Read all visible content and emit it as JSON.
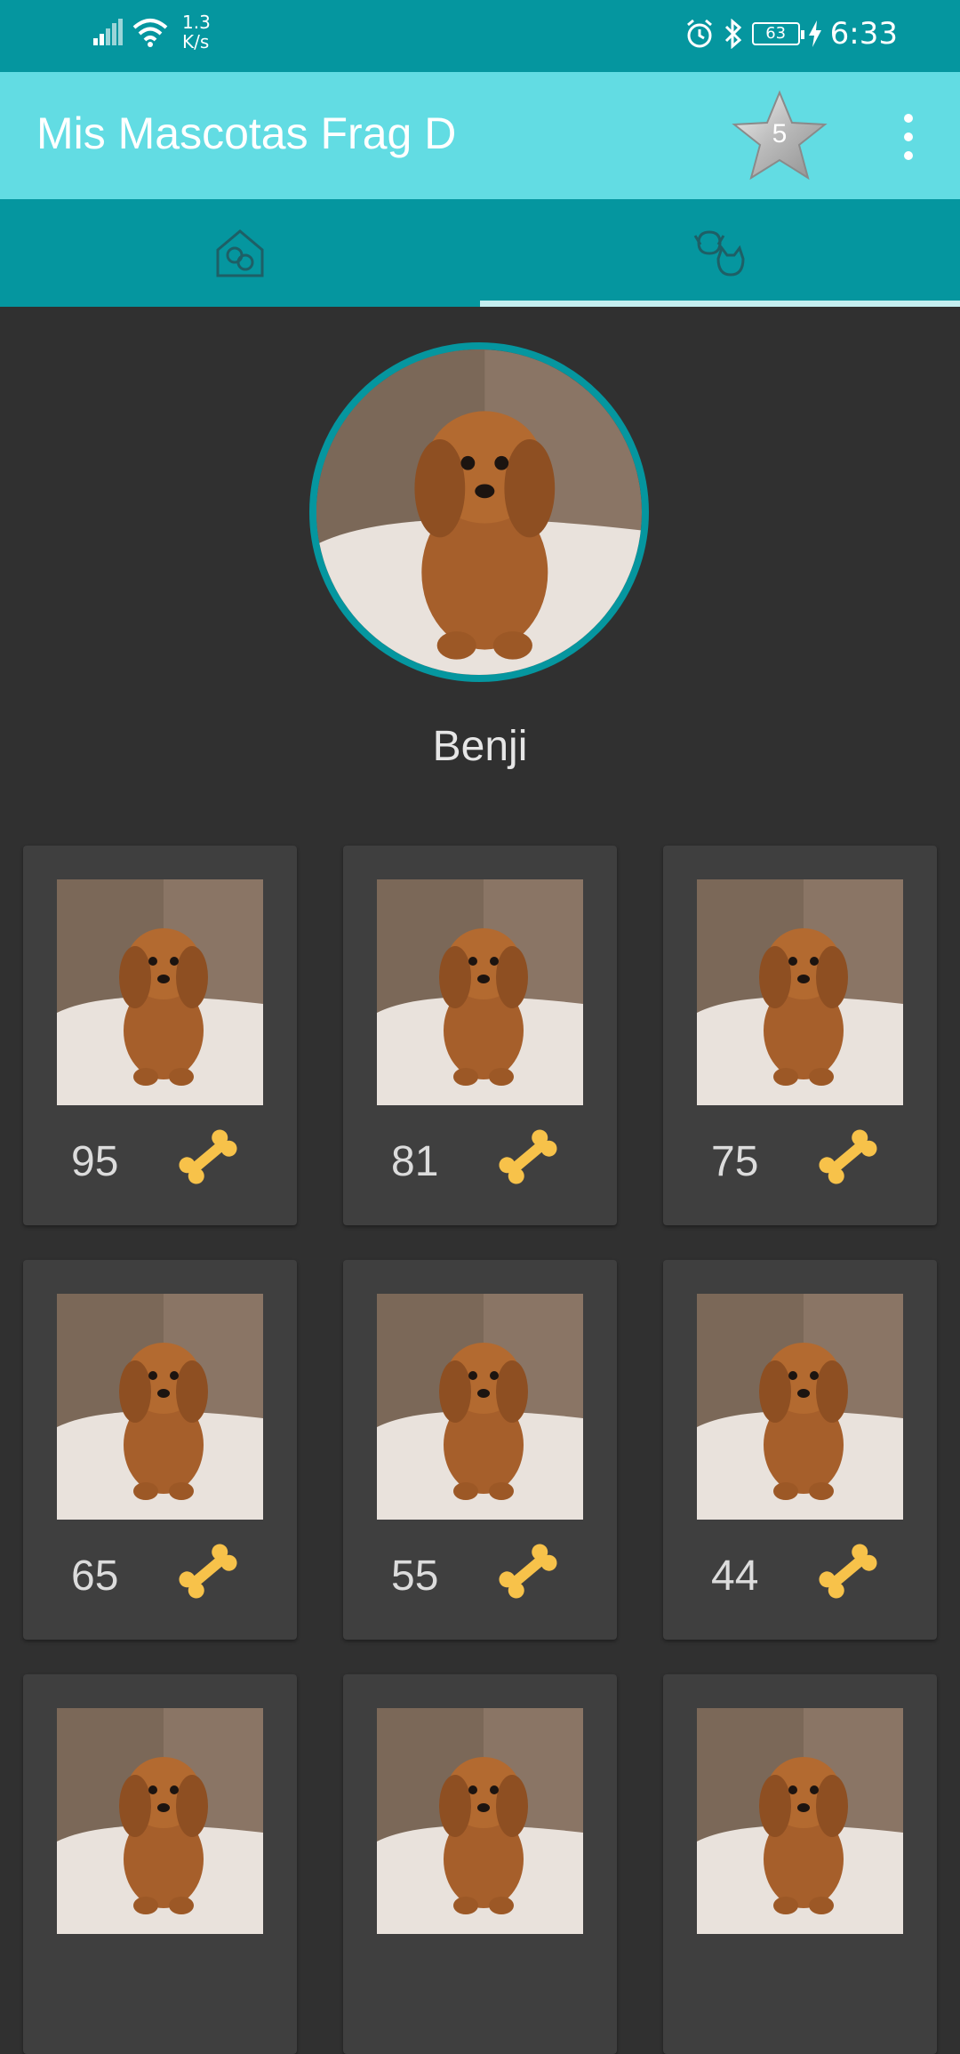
{
  "status_bar": {
    "network_speed_value": "1.3",
    "network_speed_unit": "K/s",
    "battery_level": "63",
    "time": "6:33"
  },
  "app_bar": {
    "title": "Mis Mascotas Frag D",
    "star_count": "5"
  },
  "tabs": [
    {
      "name": "home-pets",
      "icon": "house-pets-icon",
      "selected": false
    },
    {
      "name": "pet-profile",
      "icon": "dog-cat-icon",
      "selected": true
    }
  ],
  "profile": {
    "name": "Benji"
  },
  "grid": {
    "items": [
      {
        "rating": "95",
        "icon": "bone-icon"
      },
      {
        "rating": "81",
        "icon": "bone-icon"
      },
      {
        "rating": "75",
        "icon": "bone-icon"
      },
      {
        "rating": "65",
        "icon": "bone-icon"
      },
      {
        "rating": "55",
        "icon": "bone-icon"
      },
      {
        "rating": "44",
        "icon": "bone-icon"
      },
      {
        "rating": "",
        "icon": ""
      },
      {
        "rating": "",
        "icon": ""
      },
      {
        "rating": "",
        "icon": ""
      }
    ]
  },
  "colors": {
    "status_bar": "#05969f",
    "app_bar": "#62dce3",
    "tab_bar": "#05969f",
    "background": "#303030",
    "card": "#3f3f3f",
    "bone": "#f7c24a"
  }
}
